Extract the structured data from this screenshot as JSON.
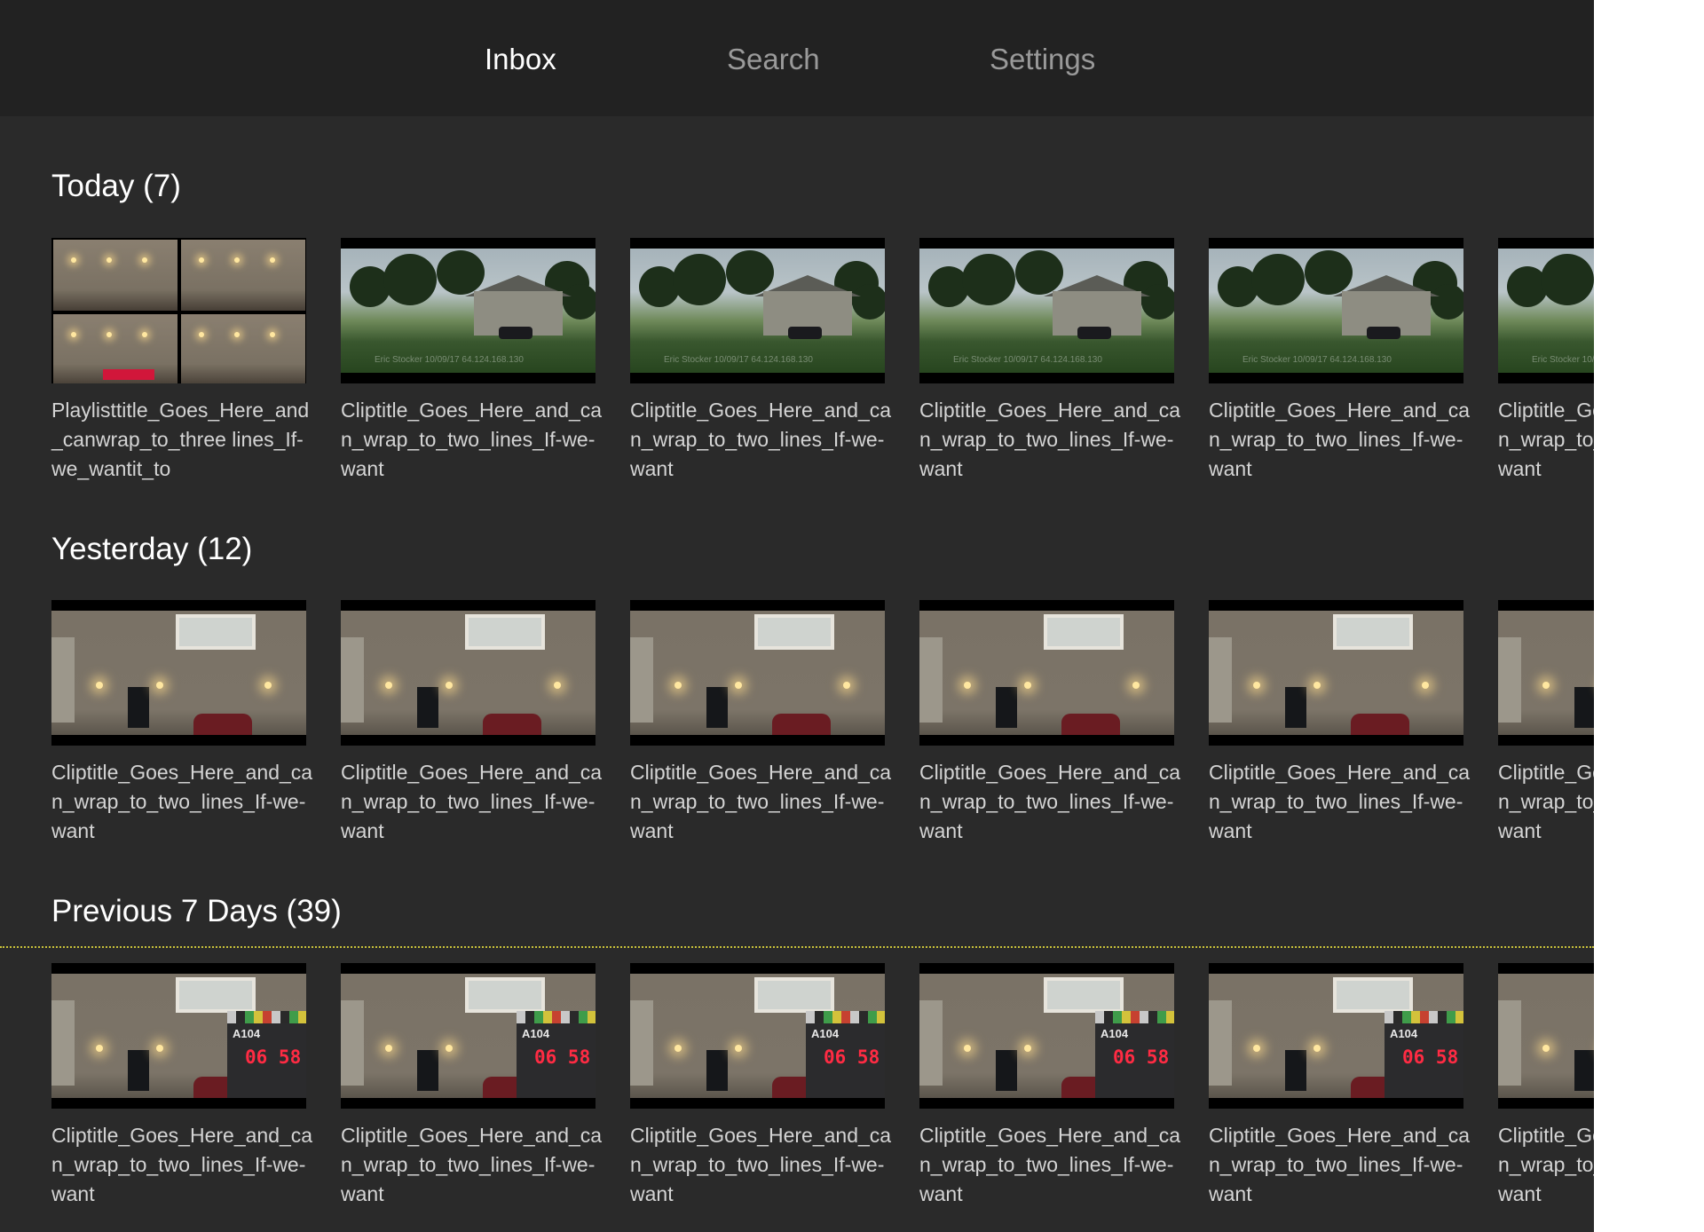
{
  "nav": {
    "tabs": [
      {
        "label": "Inbox",
        "active": true
      },
      {
        "label": "Search",
        "active": false
      },
      {
        "label": "Settings",
        "active": false
      }
    ]
  },
  "sections": [
    {
      "title": "Today (7)",
      "items": [
        {
          "caption": "Playlisttitle_Goes_Here_and_canwrap_to_three lines_If-we_wantit_to",
          "thumb": "multi-camera-grid"
        },
        {
          "caption": "Cliptitle_Goes_Here_and_can_wrap_to_two_lines_If-we-want",
          "thumb": "house-yard"
        },
        {
          "caption": "Cliptitle_Goes_Here_and_can_wrap_to_two_lines_If-we-want",
          "thumb": "house-yard"
        },
        {
          "caption": "Cliptitle_Goes_Here_and_can_wrap_to_two_lines_If-we-want",
          "thumb": "house-yard"
        },
        {
          "caption": "Cliptitle_Goes_Here_and_can_wrap_to_two_lines_If-we-want",
          "thumb": "house-yard"
        },
        {
          "caption": "Cliptitle_Goes_Here_and_can_wrap_to_two_lines_If-we-want",
          "thumb": "house-yard"
        }
      ]
    },
    {
      "title": "Yesterday  (12)",
      "items": [
        {
          "caption": "Cliptitle_Goes_Here_and_can_wrap_to_two_lines_If-we-want",
          "thumb": "house-front"
        },
        {
          "caption": "Cliptitle_Goes_Here_and_can_wrap_to_two_lines_If-we-want",
          "thumb": "house-front"
        },
        {
          "caption": "Cliptitle_Goes_Here_and_can_wrap_to_two_lines_If-we-want",
          "thumb": "house-front"
        },
        {
          "caption": "Cliptitle_Goes_Here_and_can_wrap_to_two_lines_If-we-want",
          "thumb": "house-front"
        },
        {
          "caption": "Cliptitle_Goes_Here_and_can_wrap_to_two_lines_If-we-want",
          "thumb": "house-front"
        },
        {
          "caption": "Cliptitle_Goes_Here_and_can_wrap_to_two_lines_If-we-want",
          "thumb": "house-front"
        }
      ]
    },
    {
      "title": "Previous 7 Days (39)",
      "items": [
        {
          "caption": "Cliptitle_Goes_Here_and_can_wrap_to_two_lines_If-we-want",
          "thumb": "house-slate"
        },
        {
          "caption": "Cliptitle_Goes_Here_and_can_wrap_to_two_lines_If-we-want",
          "thumb": "house-slate"
        },
        {
          "caption": "Cliptitle_Goes_Here_and_can_wrap_to_two_lines_If-we-want",
          "thumb": "house-slate"
        },
        {
          "caption": "Cliptitle_Goes_Here_and_can_wrap_to_two_lines_If-we-want",
          "thumb": "house-slate"
        },
        {
          "caption": "Cliptitle_Goes_Here_and_can_wrap_to_two_lines_If-we-want",
          "thumb": "house-slate"
        },
        {
          "caption": "Cliptitle_Goes_Here_and_can_wrap_to_two_lines_If-we-want",
          "thumb": "house-slate"
        }
      ]
    }
  ],
  "thumbnail_text": {
    "watermark": "Eric Stocker 10/09/17 64.124.168.130",
    "slate_scene": "A104",
    "slate_timecode": "06 58"
  },
  "colors": {
    "background": "#2a2a2a",
    "topbar": "#222222",
    "tab_active": "#ffffff",
    "tab_inactive": "#9a9a9a",
    "caption": "#d4d4d4",
    "divider": "#c9c23a"
  }
}
